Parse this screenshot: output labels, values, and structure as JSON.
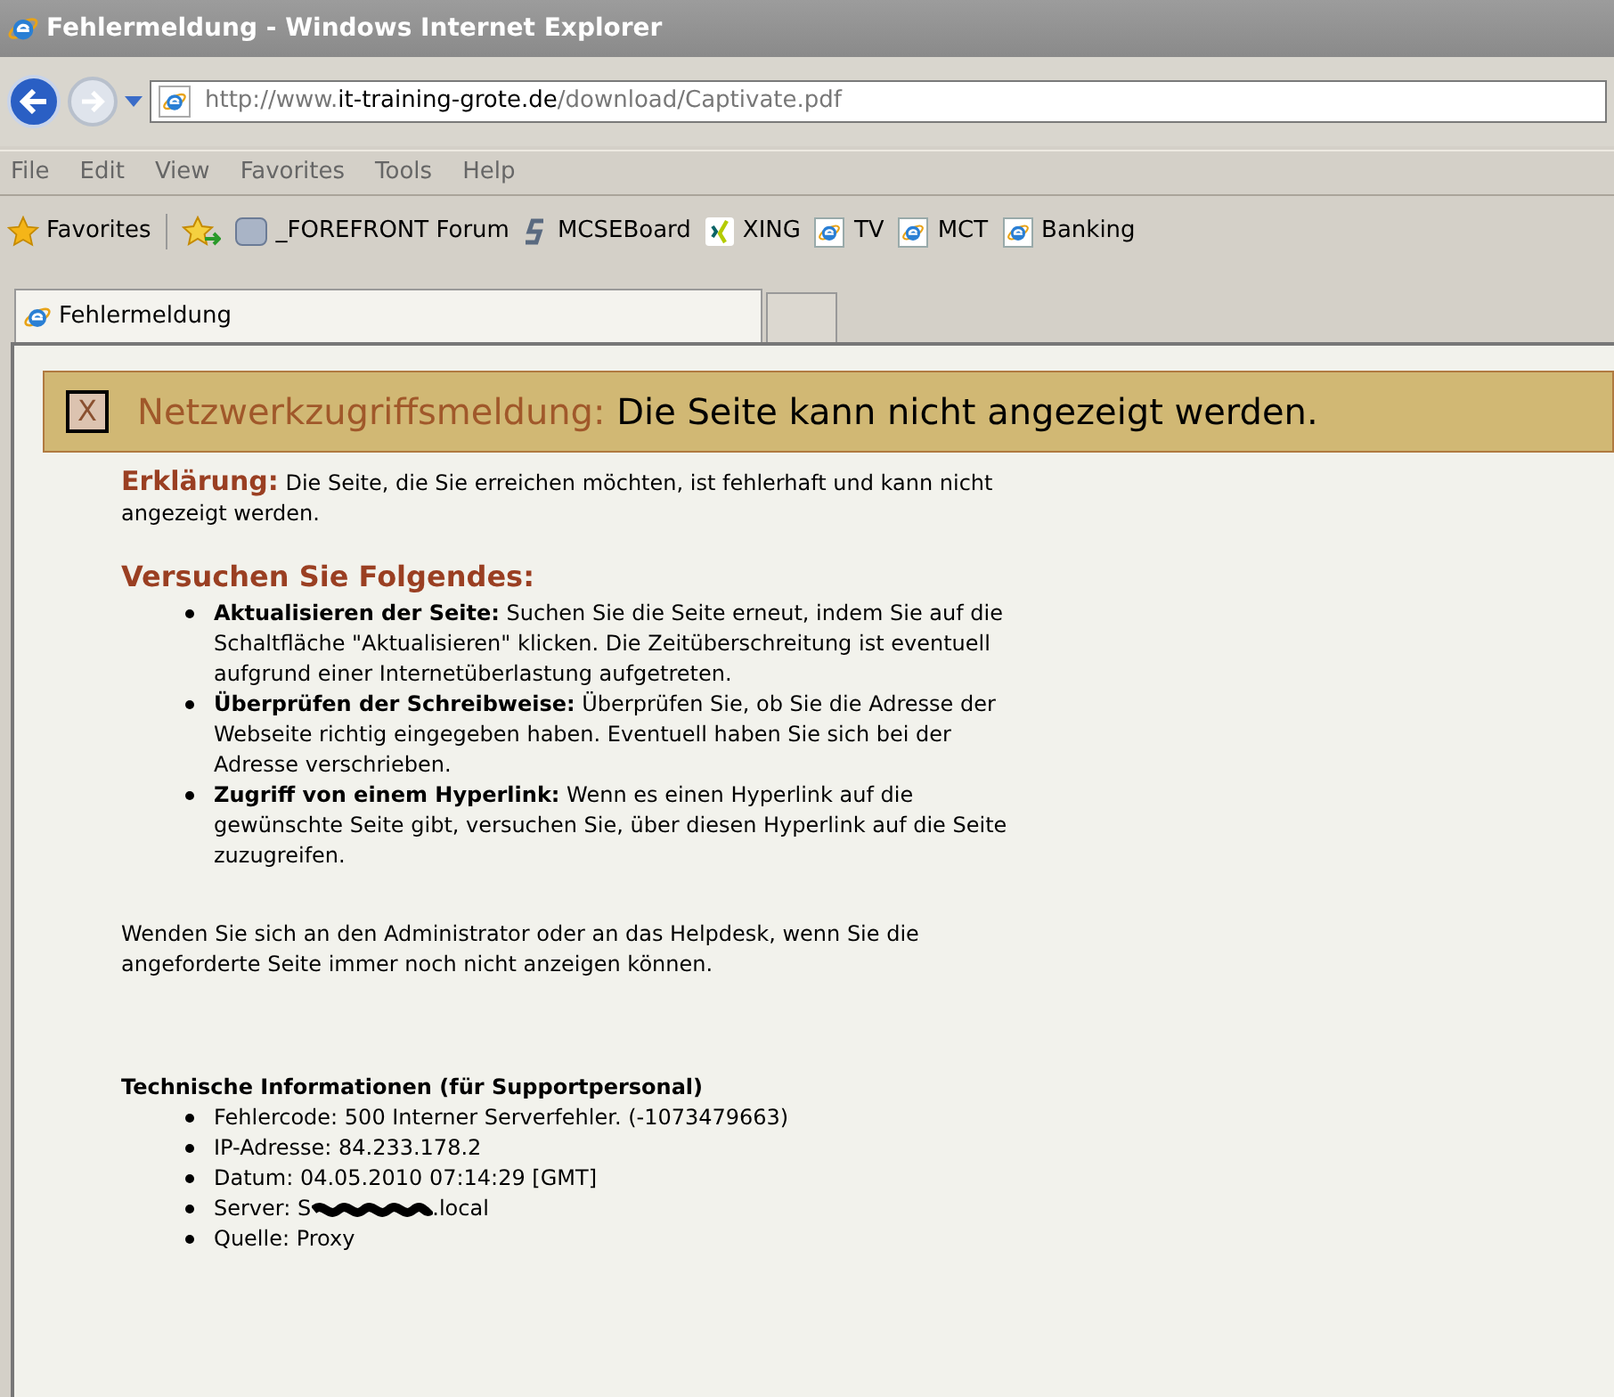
{
  "window": {
    "title": "Fehlermeldung - Windows Internet Explorer"
  },
  "address": {
    "prefix": "http://www.",
    "domain": "it-training-grote.de",
    "path": "/download/Captivate.pdf"
  },
  "menu": [
    "File",
    "Edit",
    "View",
    "Favorites",
    "Tools",
    "Help"
  ],
  "favorites_bar": {
    "label": "Favorites",
    "items": [
      {
        "label": "_FOREFRONT Forum",
        "kind": "tn"
      },
      {
        "label": "MCSEBoard",
        "kind": "s"
      },
      {
        "label": "XING",
        "kind": "xing"
      },
      {
        "label": "TV",
        "kind": "ie"
      },
      {
        "label": "MCT",
        "kind": "ie"
      },
      {
        "label": "Banking",
        "kind": "ie"
      }
    ]
  },
  "tabs": [
    {
      "label": "Fehlermeldung",
      "selected": true
    }
  ],
  "banner": {
    "icon": "X",
    "label": "Netzwerkzugriffsmeldung:",
    "message": "Die Seite kann nicht angezeigt werden."
  },
  "explanation": {
    "label": "Erklärung:",
    "text": "Die Seite, die Sie erreichen möchten, ist fehlerhaft und kann nicht angezeigt werden."
  },
  "suggestions": {
    "heading": "Versuchen Sie Folgendes:",
    "items": [
      "**Aktualisieren der Seite:** Suchen Sie die Seite erneut, indem Sie auf die Schaltfläche \"Aktualisieren\" klicken. Die Zeitüberschreitung ist eventuell aufgrund einer Internetüberlastung aufgetreten.",
      "**Überprüfen der Schreibweise:** Überprüfen Sie, ob Sie die Adresse der Webseite richtig eingegeben haben. Eventuell haben Sie sich bei der Adresse verschrieben.",
      "**Zugriff von einem Hyperlink:** Wenn es einen Hyperlink auf die gewünschte Seite gibt, versuchen Sie, über diesen Hyperlink auf die Seite zuzugreifen."
    ]
  },
  "contact": "Wenden Sie sich an den Administrator oder an das Helpdesk, wenn Sie die angeforderte Seite immer noch nicht anzeigen können.",
  "technical": {
    "heading": "Technische Informationen (für Supportpersonal)",
    "items": [
      {
        "kind": "plain",
        "text": "Fehlercode: 500 Interner Serverfehler. (-1073479663)"
      },
      {
        "kind": "plain",
        "text": "IP-Adresse: 84.233.178.2"
      },
      {
        "kind": "plain",
        "text": "Datum: 04.05.2010 07:14:29 [GMT]"
      },
      {
        "kind": "redacted",
        "text": "Server: S",
        "suffix": ".local"
      },
      {
        "kind": "plain",
        "text": "Quelle: Proxy"
      }
    ]
  }
}
